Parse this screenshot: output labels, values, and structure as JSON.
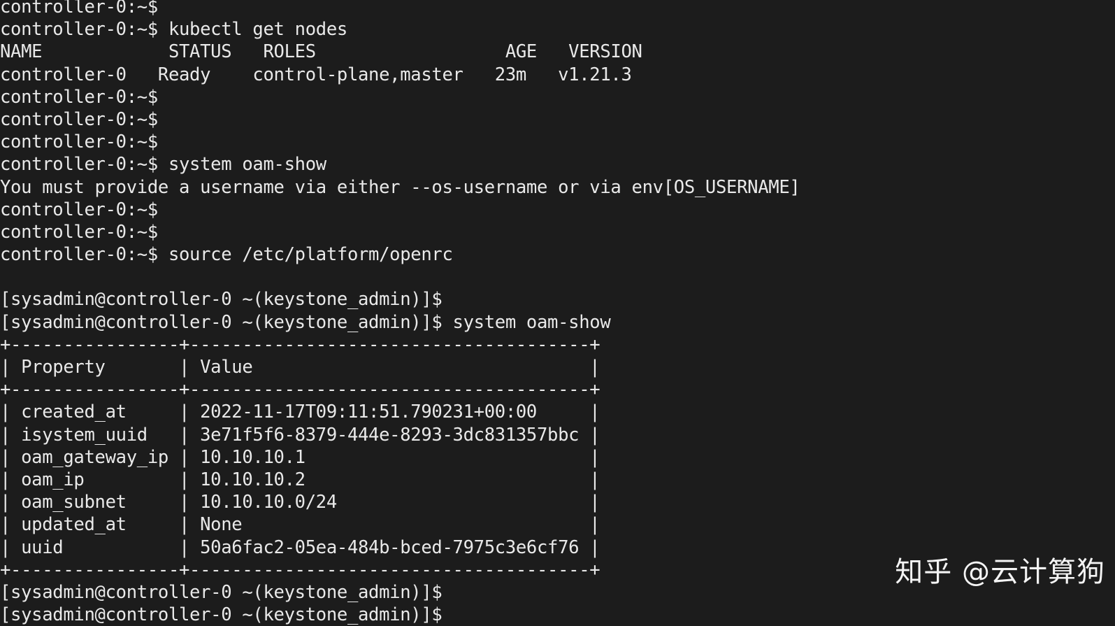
{
  "terminal": {
    "app": "terminal-console",
    "background_color": "#1c1c1c",
    "foreground_color": "#e9e9e9",
    "prompt_simple": "controller-0:~$",
    "prompt_keystone": "[sysadmin@controller-0 ~(keystone_admin)]$",
    "commands": {
      "kubectl_get_nodes": "kubectl get nodes",
      "system_oam_show": "system oam-show",
      "source_openrc": "source /etc/platform/openrc"
    },
    "error_message": "You must provide a username via either --os-username or via env[OS_USERNAME]",
    "nodes_table": {
      "headers": [
        "NAME",
        "STATUS",
        "ROLES",
        "AGE",
        "VERSION"
      ],
      "rows": [
        [
          "controller-0",
          "Ready",
          "control-plane,master",
          "23m",
          "v1.21.3"
        ]
      ]
    },
    "oam_table": {
      "headers": [
        "Property",
        "Value"
      ],
      "rows": [
        [
          "created_at",
          "2022-11-17T09:11:51.790231+00:00"
        ],
        [
          "isystem_uuid",
          "3e71f5f6-8379-444e-8293-3dc831357bbc"
        ],
        [
          "oam_gateway_ip",
          "10.10.10.1"
        ],
        [
          "oam_ip",
          "10.10.10.2"
        ],
        [
          "oam_subnet",
          "10.10.10.0/24"
        ],
        [
          "updated_at",
          "None"
        ],
        [
          "uuid",
          "50a6fac2-05ea-484b-bced-7975c3e6cf76"
        ]
      ]
    },
    "lines": [
      "controller-0:~$",
      "controller-0:~$ kubectl get nodes",
      "NAME            STATUS   ROLES                  AGE   VERSION",
      "controller-0   Ready    control-plane,master   23m   v1.21.3",
      "controller-0:~$",
      "controller-0:~$",
      "controller-0:~$",
      "controller-0:~$ system oam-show",
      "You must provide a username via either --os-username or via env[OS_USERNAME]",
      "controller-0:~$",
      "controller-0:~$",
      "controller-0:~$ source /etc/platform/openrc",
      "",
      "[sysadmin@controller-0 ~(keystone_admin)]$",
      "[sysadmin@controller-0 ~(keystone_admin)]$ system oam-show",
      "+----------------+--------------------------------------+",
      "| Property       | Value                                |",
      "+----------------+--------------------------------------+",
      "| created_at     | 2022-11-17T09:11:51.790231+00:00     |",
      "| isystem_uuid   | 3e71f5f6-8379-444e-8293-3dc831357bbc |",
      "| oam_gateway_ip | 10.10.10.1                           |",
      "| oam_ip         | 10.10.10.2                           |",
      "| oam_subnet     | 10.10.10.0/24                        |",
      "| updated_at     | None                                 |",
      "| uuid           | 50a6fac2-05ea-484b-bced-7975c3e6cf76 |",
      "+----------------+--------------------------------------+",
      "[sysadmin@controller-0 ~(keystone_admin)]$",
      "[sysadmin@controller-0 ~(keystone_admin)]$"
    ]
  },
  "watermark": {
    "text": "知乎 @云计算狗"
  }
}
